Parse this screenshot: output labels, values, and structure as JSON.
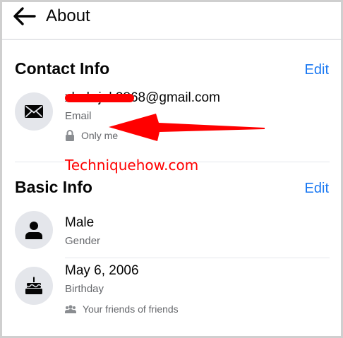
{
  "header": {
    "title": "About",
    "back_icon": "arrow-left-icon"
  },
  "contact_info": {
    "title": "Contact Info",
    "edit_label": "Edit",
    "email": {
      "value": "xhahrjak3868@gmail.com",
      "visible_suffix": "k3868@gmail.com",
      "type_label": "Email",
      "privacy": "Only me",
      "icon": "envelope-icon",
      "privacy_icon": "lock-icon"
    }
  },
  "watermark": "Techniquehow.com",
  "basic_info": {
    "title": "Basic Info",
    "edit_label": "Edit",
    "gender": {
      "value": "Male",
      "type_label": "Gender",
      "icon": "person-icon"
    },
    "birthday": {
      "value": "May 6, 2006",
      "type_label": "Birthday",
      "privacy": "Your friends of friends",
      "icon": "cake-icon",
      "privacy_icon": "friends-icon"
    }
  },
  "colors": {
    "accent": "#1877f2",
    "annotation": "#ff0000",
    "secondary_text": "#65676b",
    "icon_bg": "#e4e6eb"
  }
}
